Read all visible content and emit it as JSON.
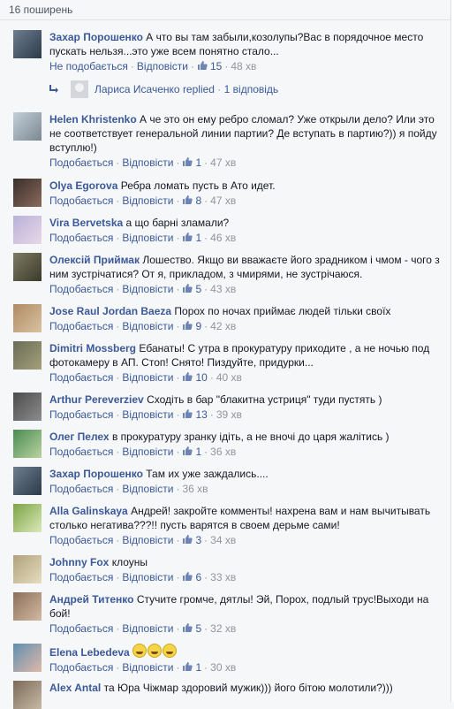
{
  "shares": {
    "label": "16 поширень"
  },
  "colors": {
    "link": "#3b5998",
    "muted": "#90949c",
    "background": "#f6f7f9"
  },
  "icons": {
    "like": "thumbs-up-icon",
    "reply": "reply-arrow-icon",
    "emoji": "laughing-emoji-icon"
  },
  "comments": [
    {
      "author": "Захар Порошенко",
      "text": "А что вы там забыли,козолупы?Вас в порядочное место пускать нельзя...это уже всем понятно стало...",
      "like_label": "Не подобається",
      "reply_label": "Відповісти",
      "likes": "15",
      "time": "48 хв"
    },
    {
      "author": "Helen Khristenko",
      "text": "А че это он ему ребро сломал? Уже открыли дело? Или это не соответствует генеральной линии партии? Де вступать в партию?)) я пойду вступлю!)",
      "like_label": "Подобається",
      "reply_label": "Відповісти",
      "likes": "1",
      "time": "47 хв"
    },
    {
      "author": "Olya Egorova",
      "text": "Ребра ломать пусть в Ато идет.",
      "like_label": "Подобається",
      "reply_label": "Відповісти",
      "likes": "8",
      "time": "47 хв"
    },
    {
      "author": "Vira Bervetska",
      "text": "а що барні зламали?",
      "like_label": "Подобається",
      "reply_label": "Відповісти",
      "likes": "1",
      "time": "46 хв"
    },
    {
      "author": "Олексій Приймак",
      "text": "Лошество. Якщо ви вважаєте його зрадником і чмом - чого з ним зустрічатися? От я, прикладом, з чмирями, не зустрічаюся.",
      "like_label": "Подобається",
      "reply_label": "Відповісти",
      "likes": "5",
      "time": "43 хв"
    },
    {
      "author": "Jose Raul Jordan Baeza",
      "text": "Порох по ночах приймає людей тільки своїх",
      "like_label": "Подобається",
      "reply_label": "Відповісти",
      "likes": "9",
      "time": "42 хв"
    },
    {
      "author": "Dimitri Mossberg",
      "text": "Ебанаты! С утра в прокуратуру приходите , а не ночью под фотокамеру в АП. Стоп! Снято! Пиздуйте, придурки...",
      "like_label": "Подобається",
      "reply_label": "Відповісти",
      "likes": "10",
      "time": "40 хв"
    },
    {
      "author": "Arthur Pereverziev",
      "text": "Сходіть в бар \"блакитна устриця\" туди пустять )",
      "like_label": "Подобається",
      "reply_label": "Відповісти",
      "likes": "13",
      "time": "39 хв"
    },
    {
      "author": "Олег Пелех",
      "text": "в прокуратуру зранку ідіть, а не вночі до царя жалітись )",
      "like_label": "Подобається",
      "reply_label": "Відповісти",
      "likes": "1",
      "time": "36 хв"
    },
    {
      "author": "Захар Порошенко",
      "text": "Там их уже заждались....",
      "like_label": "Подобається",
      "reply_label": "Відповісти",
      "likes": "",
      "time": "36 хв"
    },
    {
      "author": "Alla Galinskaya",
      "text": "Андрей! закройте комменты! нахрена вам и нам вычитывать столько негатива???!! пусть варятся в своем дерьме сами!",
      "like_label": "Подобається",
      "reply_label": "Відповісти",
      "likes": "3",
      "time": "34 хв"
    },
    {
      "author": "Johnny Fox",
      "text": "клоуны",
      "like_label": "Подобається",
      "reply_label": "Відповісти",
      "likes": "6",
      "time": "33 хв"
    },
    {
      "author": "Андрей Титенко",
      "text": "Стучите громче, дятлы! Эй, Порох, подлый трус!Выходи на бой!",
      "like_label": "Подобається",
      "reply_label": "Відповісти",
      "likes": "5",
      "time": "32 хв"
    },
    {
      "author": "Elena Lebedeva",
      "text": "",
      "like_label": "Подобається",
      "reply_label": "Відповісти",
      "likes": "1",
      "time": "30 хв"
    },
    {
      "author": "Alex Antal",
      "text": "та Юра Чіжмар здоровий мужик))) його бітою молотили?)))",
      "like_label": "",
      "reply_label": "",
      "likes": "",
      "time": ""
    }
  ],
  "reply_thread": {
    "name": "Лариса Исаченко",
    "action": "replied",
    "count_label": "1 відповідь"
  }
}
